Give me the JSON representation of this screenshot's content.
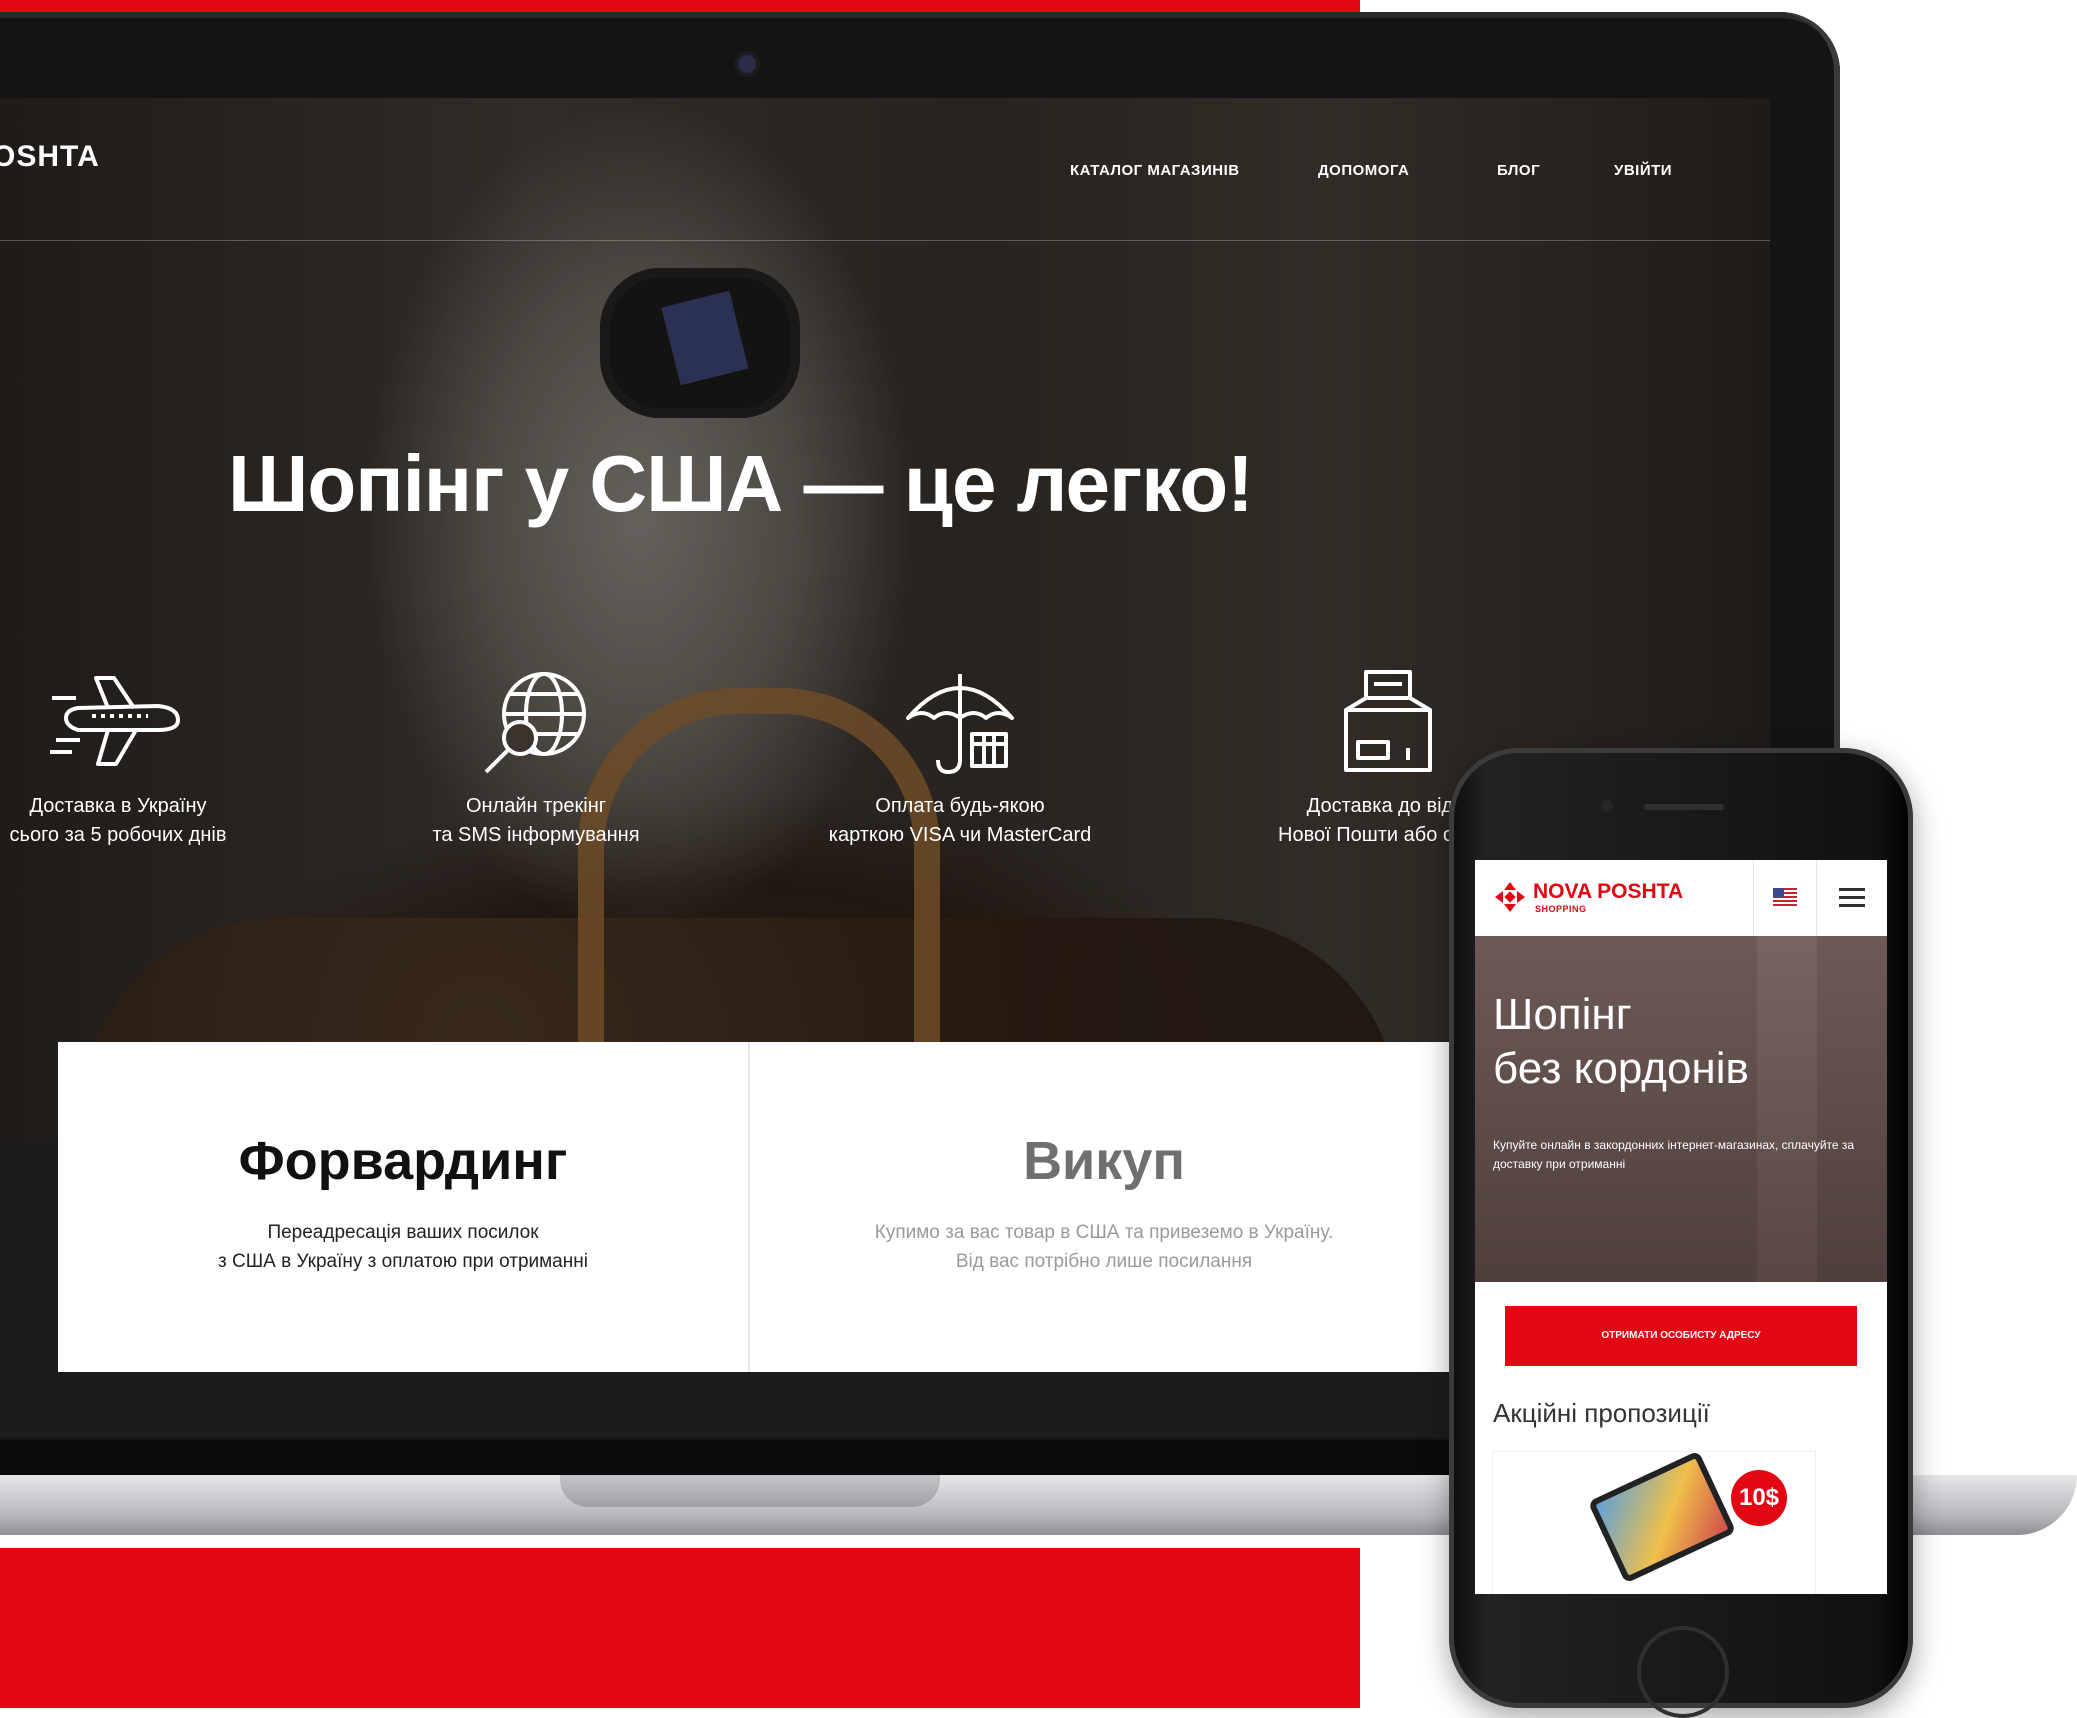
{
  "site": {
    "logo_text": "OSHTA",
    "nav": [
      "КАТАЛОГ МАГАЗИНІВ",
      "ДОПОМОГА",
      "БЛОГ",
      "УВІЙТИ"
    ],
    "headline": "Шопінг у США — це легко!"
  },
  "features": [
    {
      "icon": "airplane-icon",
      "lines": [
        "Доставка в Україну",
        "сього за 5 робочих днів"
      ]
    },
    {
      "icon": "globe-search-icon",
      "lines": [
        "Онлайн трекінг",
        "та SMS інформування"
      ]
    },
    {
      "icon": "umbrella-box-icon",
      "lines": [
        "Оплата будь-якою",
        "карткою VISA чи MasterCard"
      ]
    },
    {
      "icon": "box-scale-icon",
      "lines": [
        "Доставка до відді",
        "Нової Пошти або особи"
      ]
    }
  ],
  "services": [
    {
      "title": "Форвардинг",
      "lines": [
        "Переадресація ваших посилок",
        "з США в Україну з оплатою при отриманні"
      ]
    },
    {
      "title": "Викуп",
      "lines": [
        "Купимо за вас товар в США та привеземо в Україну.",
        "Від вас потрібно лише посилання"
      ]
    }
  ],
  "mobile": {
    "logo_text": "NOVA POSHTA",
    "logo_sub": "SHOPPING",
    "hero_title": [
      "Шопінг",
      "без кордонів"
    ],
    "hero_text": "Купуйте онлайн в закордонних інтернет-магазинах, сплачуйте за доставку при отриманні",
    "cta": "ОТРИМАТИ ОСОБИСТУ АДРЕСУ",
    "promo_title": "Акційні пропозиції",
    "promo_price": "10$"
  },
  "colors": {
    "brand_red": "#e30613",
    "inactive_title": "#6f6f6f"
  }
}
